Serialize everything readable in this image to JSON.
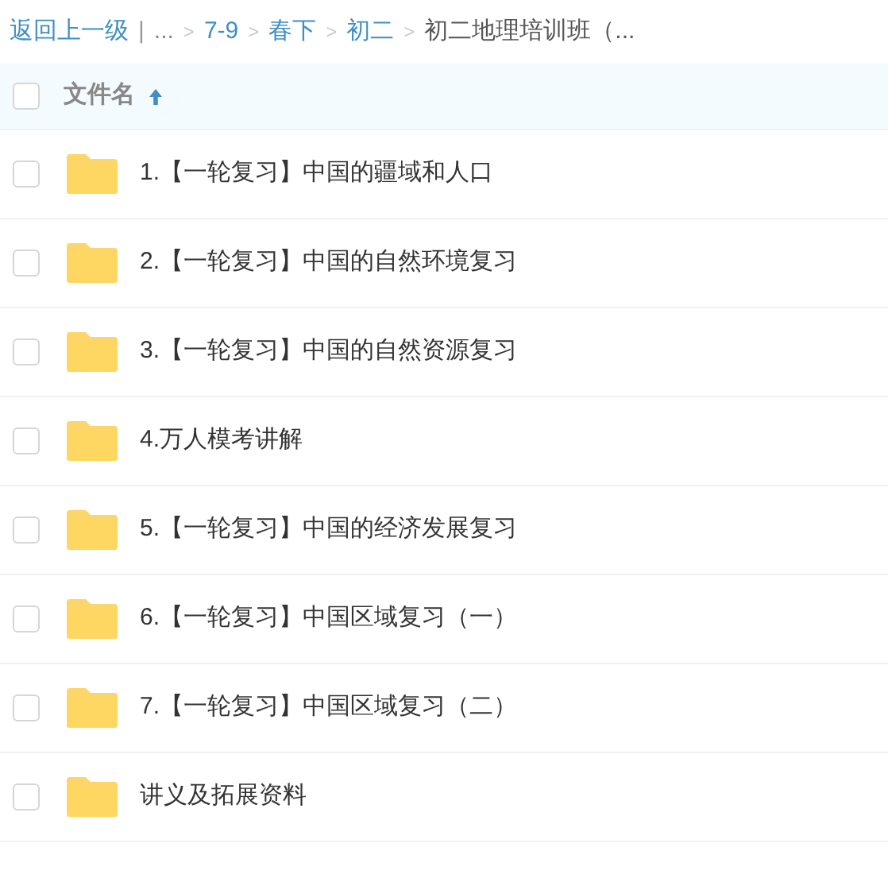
{
  "breadcrumb": {
    "back": "返回上一级",
    "separator": "|",
    "items": [
      {
        "label": "...",
        "kind": "ellipsis"
      },
      {
        "label": "7-9",
        "kind": "link"
      },
      {
        "label": "春下",
        "kind": "link"
      },
      {
        "label": "初二",
        "kind": "link"
      },
      {
        "label": "初二地理培训班（...",
        "kind": "current"
      }
    ],
    "arrow": ">"
  },
  "header": {
    "checked": false,
    "column": "文件名",
    "sort_ascending": true
  },
  "files": [
    {
      "name": "1.【一轮复习】中国的疆域和人口",
      "checked": false
    },
    {
      "name": "2.【一轮复习】中国的自然环境复习",
      "checked": false
    },
    {
      "name": "3.【一轮复习】中国的自然资源复习",
      "checked": false
    },
    {
      "name": "4.万人模考讲解",
      "checked": false
    },
    {
      "name": "5.【一轮复习】中国的经济发展复习",
      "checked": false
    },
    {
      "name": "6.【一轮复习】中国区域复习（一）",
      "checked": false
    },
    {
      "name": "7.【一轮复习】中国区域复习（二）",
      "checked": false
    },
    {
      "name": "讲义及拓展资料",
      "checked": false
    }
  ]
}
